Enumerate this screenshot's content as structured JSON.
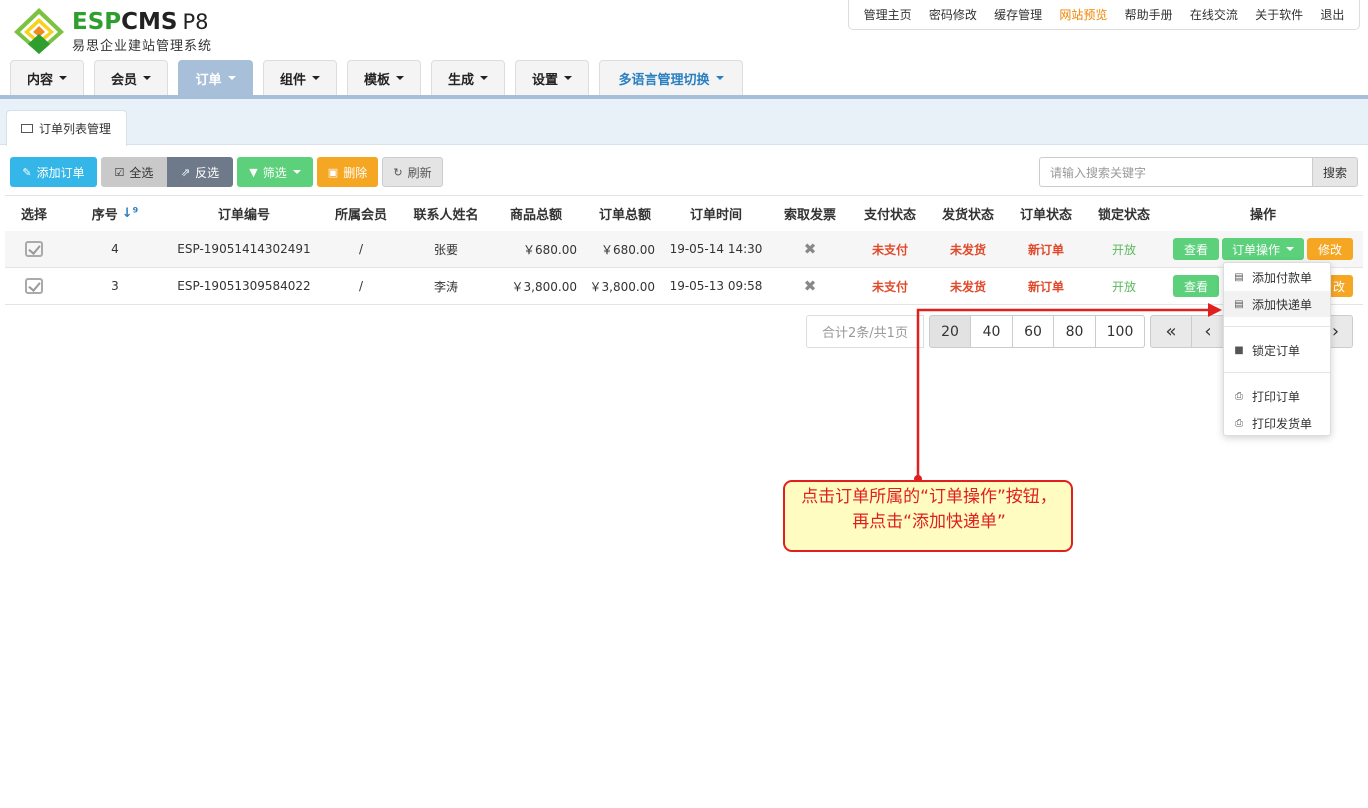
{
  "brand": {
    "esp": "ESP",
    "cms": "CMS",
    "version": "P8",
    "subtitle": "易思企业建站管理系统"
  },
  "top_nav": [
    "管理主页",
    "密码修改",
    "缓存管理",
    "网站预览",
    "帮助手册",
    "在线交流",
    "关于软件",
    "退出"
  ],
  "top_nav_highlight_color": "#f08300",
  "main_nav": [
    "内容",
    "会员",
    "订单",
    "组件",
    "模板",
    "生成",
    "设置",
    "多语言管理切换"
  ],
  "main_nav_active": "订单",
  "sub_tab": "订单列表管理",
  "toolbar": {
    "add_order": "添加订单",
    "select_all": "全选",
    "invert": "反选",
    "filter": "筛选",
    "delete": "删除",
    "refresh": "刷新",
    "search_placeholder": "请输入搜索关键字",
    "search_button": "搜索"
  },
  "table": {
    "headers": [
      "选择",
      "序号",
      "订单编号",
      "所属会员",
      "联系人姓名",
      "商品总额",
      "订单总额",
      "订单时间",
      "索取发票",
      "支付状态",
      "发货状态",
      "订单状态",
      "锁定状态",
      "操作"
    ],
    "rows": [
      {
        "seq": "4",
        "order_no": "ESP-19051414302491",
        "member": "/",
        "contact": "张要",
        "goods_total": "￥680.00",
        "order_total": "￥680.00",
        "time": "19-05-14 14:30",
        "pay": "未支付",
        "ship": "未发货",
        "status": "新订单",
        "lock": "开放"
      },
      {
        "seq": "3",
        "order_no": "ESP-19051309584022",
        "member": "/",
        "contact": "李涛",
        "goods_total": "￥3,800.00",
        "order_total": "￥3,800.00",
        "time": "19-05-13 09:58",
        "pay": "未支付",
        "ship": "未发货",
        "status": "新订单",
        "lock": "开放"
      }
    ],
    "actions": {
      "view": "查看",
      "ops": "订单操作",
      "modify": "修改",
      "modify_partial": "改"
    }
  },
  "pagination": {
    "total": "合计2条/共1页",
    "sizes": [
      "20",
      "40",
      "60",
      "80",
      "100"
    ],
    "active_size": "20",
    "first": "«",
    "prev": "‹",
    "next": "›"
  },
  "dropdown": [
    "添加付款单",
    "添加快递单",
    "锁定订单",
    "打印订单",
    "打印发货单"
  ],
  "annotation": "点击订单所属的“订单操作”按钮，再点击“添加快递单”",
  "colors": {
    "blue_btn": "#35b6e8",
    "gray_btn": "#c9c9c9",
    "dark_btn": "#6e7a89",
    "green_btn": "#5cd07b",
    "orange_btn": "#f5a623",
    "nav_active": "#a7bfd9",
    "alert_red": "#e02020"
  }
}
